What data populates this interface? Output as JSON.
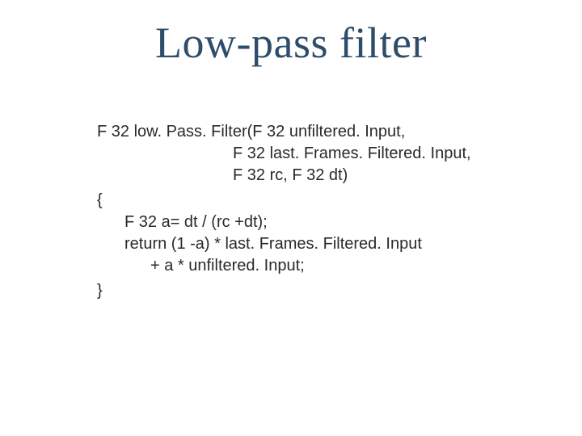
{
  "title": "Low-pass filter",
  "code": {
    "sig1": "F 32 low. Pass. Filter(F 32 unfiltered. Input,",
    "sig2": "F 32 last. Frames. Filtered. Input,",
    "sig3": "F 32 rc, F 32 dt)",
    "open": "{",
    "l1": "F 32 a= dt / (rc +dt);",
    "l2": "return (1 -a) * last. Frames. Filtered. Input",
    "l3": "+ a * unfiltered. Input;",
    "close": "}"
  }
}
